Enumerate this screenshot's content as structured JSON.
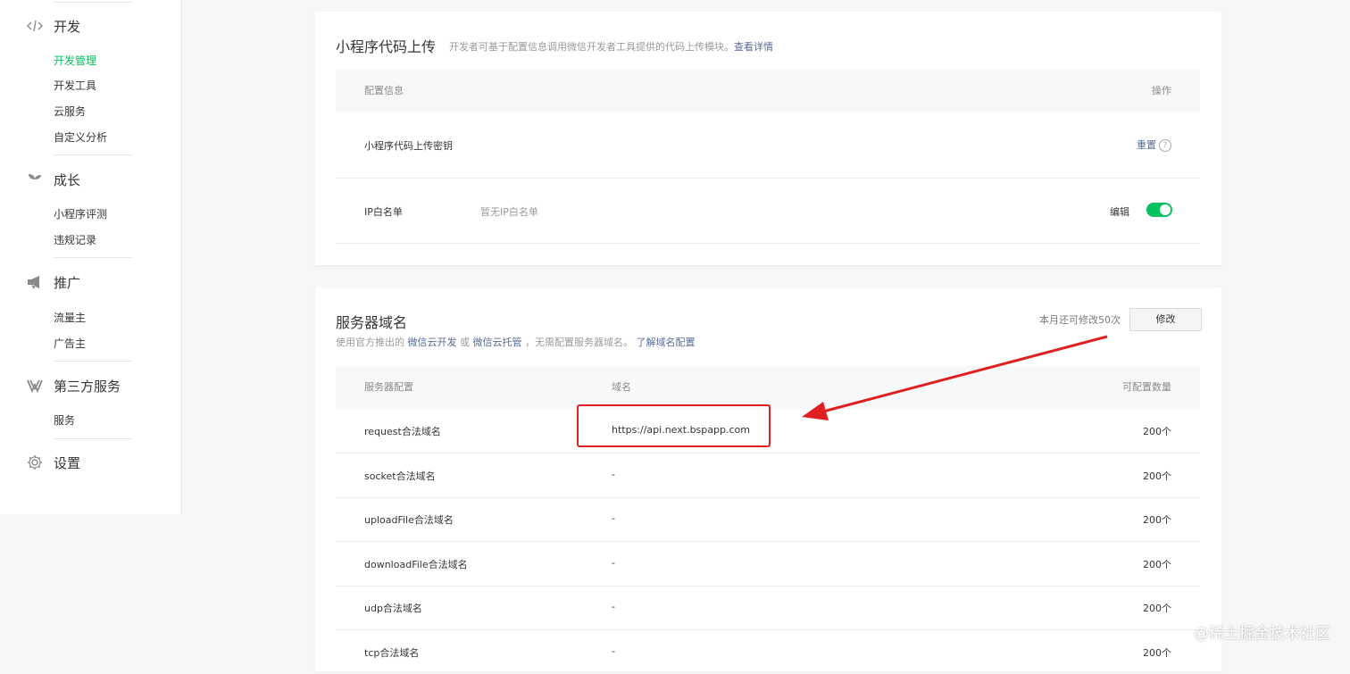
{
  "sidebar": {
    "groups": [
      {
        "title": "开发",
        "icon": "code-icon",
        "items": [
          "开发管理",
          "开发工具",
          "云服务",
          "自定义分析"
        ]
      },
      {
        "title": "成长",
        "icon": "sprout-icon",
        "items": [
          "小程序评测",
          "违规记录"
        ]
      },
      {
        "title": "推广",
        "icon": "megaphone-icon",
        "items": [
          "流量主",
          "广告主"
        ]
      },
      {
        "title": "第三方服务",
        "icon": "third-party-icon",
        "items": [
          "服务"
        ]
      },
      {
        "title": "设置",
        "icon": "gear-icon",
        "items": []
      }
    ],
    "active_item": "开发管理"
  },
  "upload_card": {
    "title": "小程序代码上传",
    "desc": "开发者可基于配置信息调用微信开发者工具提供的代码上传模块。",
    "detail_link": "查看详情",
    "headers": {
      "config": "配置信息",
      "action": "操作"
    },
    "rows": [
      {
        "name": "小程序代码上传密钥",
        "action": "重置"
      },
      {
        "name": "IP白名单",
        "value": "暂无IP白名单",
        "action": "编辑",
        "toggle_on": true
      }
    ]
  },
  "server_card": {
    "title": "服务器域名",
    "desc_prefix": "使用官方推出的",
    "link1": "微信云开发",
    "or": "或",
    "link2": "微信云托管",
    "desc_suffix": "，无需配置服务器域名。",
    "learn_link": "了解域名配置",
    "quota_text": "本月还可修改50次",
    "modify_button": "修改",
    "headers": {
      "config": "服务器配置",
      "domain": "域名",
      "count": "可配置数量"
    },
    "rows": [
      {
        "name": "request合法域名",
        "domain": "https://api.next.bspapp.com",
        "count": "200个"
      },
      {
        "name": "socket合法域名",
        "domain": "-",
        "count": "200个"
      },
      {
        "name": "uploadFile合法域名",
        "domain": "-",
        "count": "200个"
      },
      {
        "name": "downloadFile合法域名",
        "domain": "-",
        "count": "200个"
      },
      {
        "name": "udp合法域名",
        "domain": "-",
        "count": "200个"
      },
      {
        "name": "tcp合法域名",
        "domain": "-",
        "count": "200个"
      }
    ]
  },
  "annotation": {
    "color": "#e02020"
  },
  "watermark": "@稀土掘金技术社区",
  "colors": {
    "accent_green": "#07c160",
    "link_blue": "#576b95"
  }
}
